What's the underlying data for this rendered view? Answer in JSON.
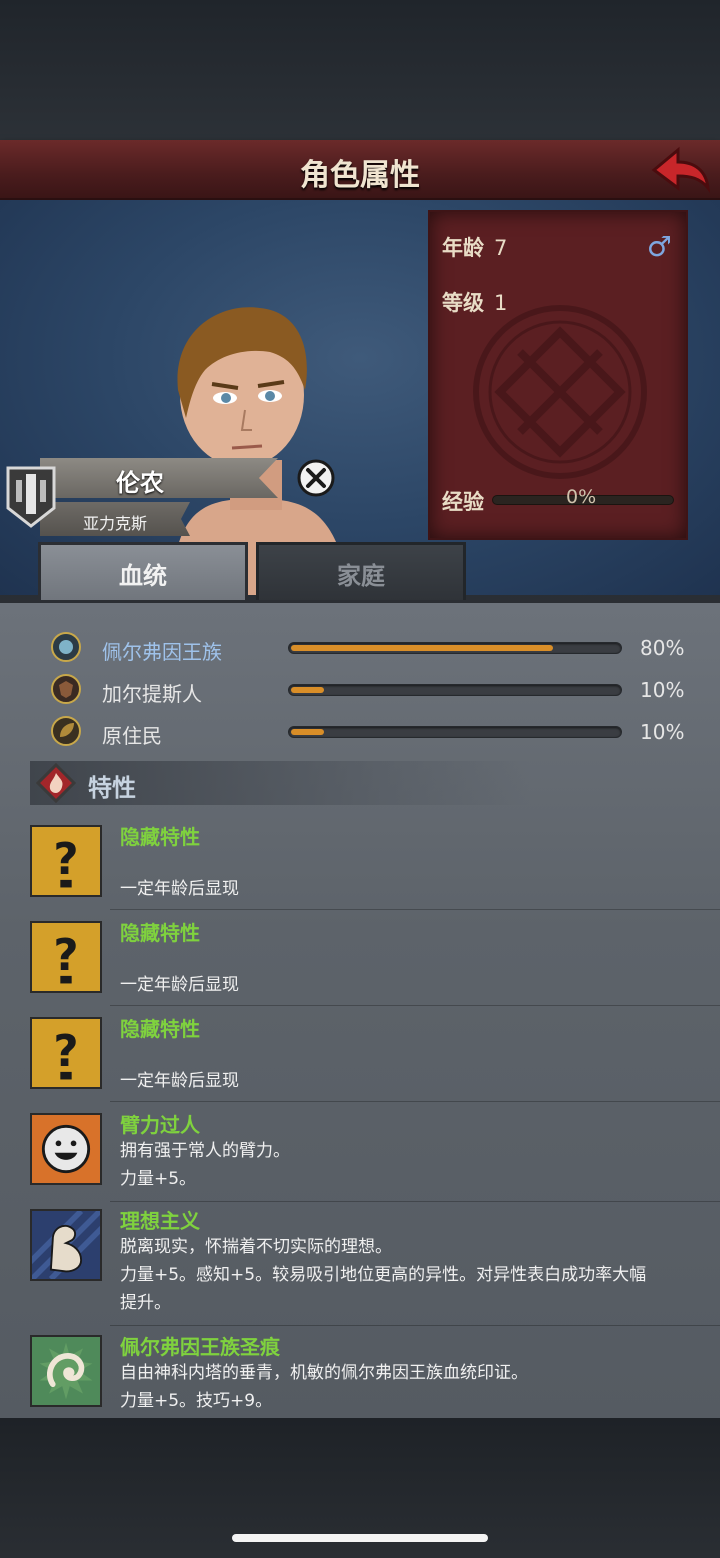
{
  "header": {
    "title": "角色属性"
  },
  "character": {
    "name": "伦农",
    "surname": "亚力克斯",
    "gender_icon": "male-icon",
    "stats": [
      {
        "label": "年龄",
        "value": "7"
      },
      {
        "label": "等级",
        "value": "1"
      }
    ],
    "exp": {
      "label": "经验",
      "percent": "0%"
    }
  },
  "tabs": [
    {
      "label": "血统",
      "active": true
    },
    {
      "label": "家庭",
      "active": false
    }
  ],
  "bloodlines": [
    {
      "name": "佩尔弗因王族",
      "percent": "80%",
      "fill": 0.8,
      "icon": "royal-crest-icon"
    },
    {
      "name": "加尔提斯人",
      "percent": "10%",
      "fill": 0.1,
      "icon": "beast-crest-icon"
    },
    {
      "name": "原住民",
      "percent": "10%",
      "fill": 0.1,
      "icon": "leaf-crest-icon"
    }
  ],
  "traits_section": {
    "title": "特性"
  },
  "traits": [
    {
      "name": "隐藏特性",
      "lines": [
        "一定年龄后显现"
      ],
      "icon": "question-mark-icon"
    },
    {
      "name": "隐藏特性",
      "lines": [
        "一定年龄后显现"
      ],
      "icon": "question-mark-icon"
    },
    {
      "name": "隐藏特性",
      "lines": [
        "一定年龄后显现"
      ],
      "icon": "question-mark-icon"
    },
    {
      "name": "臂力过人",
      "lines": [
        "拥有强于常人的臂力。",
        "力量+5。"
      ],
      "icon": "smiley-face-icon"
    },
    {
      "name": "理想主义",
      "lines": [
        "脱离现实，怀揣着不切实际的理想。",
        "力量+5。感知+5。较易吸引地位更高的异性。对异性表白成功率大幅",
        "提升。"
      ],
      "icon": "muscle-arm-icon"
    },
    {
      "name": "佩尔弗因王族圣痕",
      "lines": [
        "自由神科内塔的垂青，机敏的佩尔弗因王族血统印证。",
        "力量+5。技巧+9。"
      ],
      "icon": "swirl-emblem-icon"
    }
  ],
  "colors": {
    "title_bar": "#5b2224",
    "trait_name": "#7fd23e",
    "bar_fill": "#d98e28",
    "highlight_bloodline": "#9fc2ea"
  }
}
